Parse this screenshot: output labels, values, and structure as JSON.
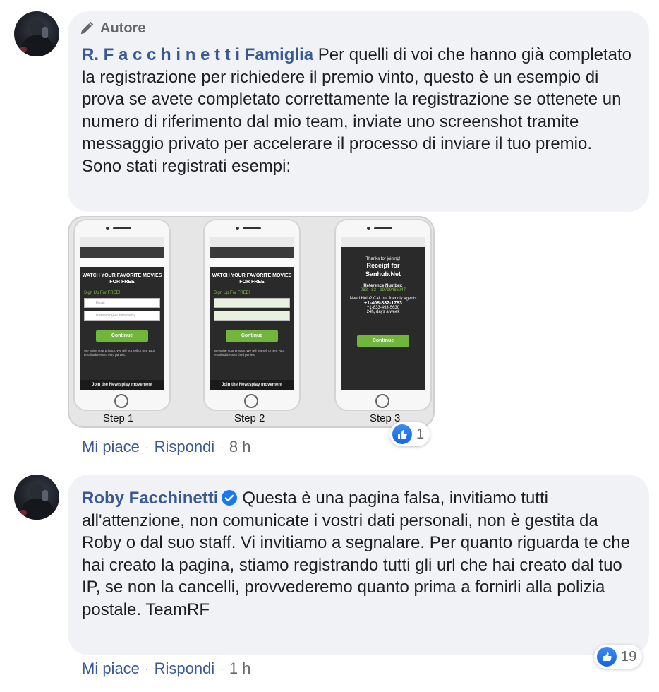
{
  "comment1": {
    "badge": "Autore",
    "author": "R. F a c c h i n e t t i Famiglia",
    "text": "Per quelli di voi che hanno già completato la registrazione per richiedere il premio vinto, questo è un esempio di prova se avete completato correttamente la registrazione se ottenete un numero di riferimento dal mio team, inviate uno screenshot tramite messaggio privato per accelerare il processo di inviare il tuo premio.",
    "text2": "Sono stati registrati esempi:",
    "image": {
      "steps": [
        "Step 1",
        "Step 2",
        "Step 3"
      ],
      "header": "WATCH YOUR FAVORITE MOVIES FOR FREE",
      "signup": "Sign Up For FREE!",
      "email_placeholder": "Email",
      "password_placeholder": "Password(4+Characters)",
      "continue": "Continue",
      "footer": "Join the Newtsplay movement",
      "thanks": "Thanks for joining!",
      "receipt": "Receipt for",
      "site": "Sanhub.Net",
      "reference_label": "Reference Number:",
      "reference_value": "083 - 82 - 19799486047",
      "help": "Need Help? Call our friendly agents",
      "phone": "+1-408-882-1783",
      "phone_alt": "+1-833-493-5630",
      "hours": "24h, days a week"
    },
    "reactions": {
      "icon": "like-icon",
      "count": "1"
    },
    "actions": {
      "like": "Mi piace",
      "reply": "Rispondi",
      "time": "8 h"
    }
  },
  "comment2": {
    "author": "Roby Facchinetti",
    "verified_icon": "verified-badge-icon",
    "text": "Questa è una pagina falsa, invitiamo tutti all'attenzione, non comunicate i vostri dati personali, non è gestita da Roby o dal suo staff. Vi invitiamo a segnalare. Per quanto riguarda te che hai creato la pagina, stiamo registrando tutti gli url che hai creato dal tuo IP, se non la cancelli, provvederemo quanto prima a fornirli alla polizia postale. TeamRF",
    "reactions": {
      "icon": "like-icon",
      "count": "19"
    },
    "actions": {
      "like": "Mi piace",
      "reply": "Rispondi",
      "time": "1 h"
    }
  },
  "colors": {
    "link": "#385898",
    "bubble": "#f0f2f5",
    "meta": "#65676b",
    "like": "#1877f2"
  }
}
